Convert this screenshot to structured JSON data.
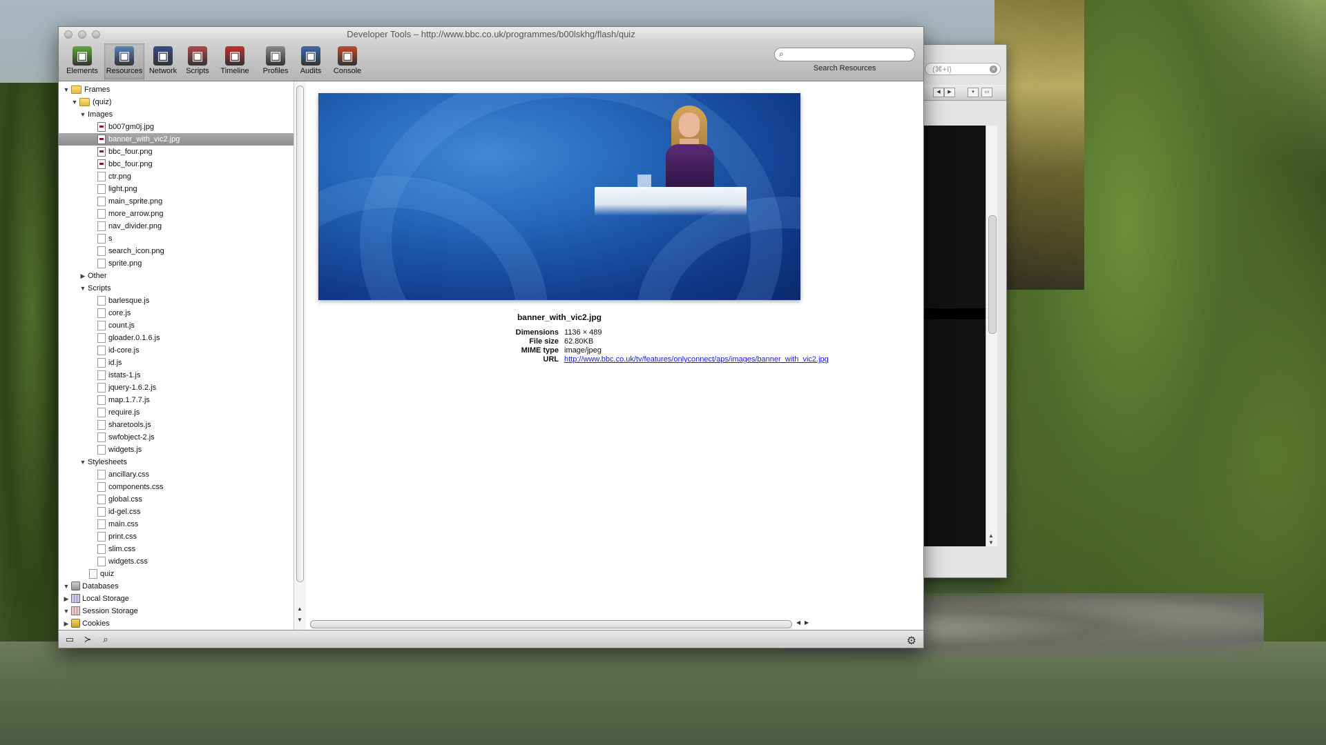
{
  "window": {
    "title": "Developer Tools – http://www.bbc.co.uk/programmes/b00lskhg/flash/quiz"
  },
  "toolbar": {
    "tools": [
      {
        "label": "Elements",
        "icon": "elements-icon",
        "color": "#5fa83c"
      },
      {
        "label": "Resources",
        "icon": "resources-icon",
        "color": "#5b7fb8",
        "active": true
      },
      {
        "label": "Network",
        "icon": "network-icon",
        "color": "#3a4a8a"
      },
      {
        "label": "Scripts",
        "icon": "scripts-icon",
        "color": "#b04848"
      },
      {
        "label": "Timeline",
        "icon": "timeline-icon",
        "color": "#c03030"
      },
      {
        "label": "Profiles",
        "icon": "profiles-icon",
        "color": "#8a8a8a"
      },
      {
        "label": "Audits",
        "icon": "audits-icon",
        "color": "#3c6aa8"
      },
      {
        "label": "Console",
        "icon": "console-icon",
        "color": "#c04a2a"
      }
    ],
    "search_label": "Search Resources",
    "search_value": ""
  },
  "sidebar": {
    "items": [
      {
        "label": "Frames",
        "depth": 0,
        "tri": "open",
        "icon": "folder"
      },
      {
        "label": "(quiz)",
        "depth": 1,
        "tri": "open",
        "icon": "folder"
      },
      {
        "label": "Images",
        "depth": 2,
        "tri": "open",
        "icon": "none"
      },
      {
        "label": "b007gm0j.jpg",
        "depth": 3,
        "icon": "img"
      },
      {
        "label": "banner_with_vic2.jpg",
        "depth": 3,
        "icon": "img",
        "selected": true
      },
      {
        "label": "bbc_four.png",
        "depth": 3,
        "icon": "img"
      },
      {
        "label": "bbc_four.png",
        "depth": 3,
        "icon": "img"
      },
      {
        "label": "ctr.png",
        "depth": 3,
        "icon": "file"
      },
      {
        "label": "light.png",
        "depth": 3,
        "icon": "file"
      },
      {
        "label": "main_sprite.png",
        "depth": 3,
        "icon": "file"
      },
      {
        "label": "more_arrow.png",
        "depth": 3,
        "icon": "file"
      },
      {
        "label": "nav_divider.png",
        "depth": 3,
        "icon": "file"
      },
      {
        "label": "s",
        "depth": 3,
        "icon": "file"
      },
      {
        "label": "search_icon.png",
        "depth": 3,
        "icon": "file"
      },
      {
        "label": "sprite.png",
        "depth": 3,
        "icon": "file"
      },
      {
        "label": "Other",
        "depth": 2,
        "tri": "closed",
        "icon": "none"
      },
      {
        "label": "Scripts",
        "depth": 2,
        "tri": "open",
        "icon": "none"
      },
      {
        "label": "barlesque.js",
        "depth": 3,
        "icon": "file"
      },
      {
        "label": "core.js",
        "depth": 3,
        "icon": "file"
      },
      {
        "label": "count.js",
        "depth": 3,
        "icon": "file"
      },
      {
        "label": "gloader.0.1.6.js",
        "depth": 3,
        "icon": "file"
      },
      {
        "label": "id-core.js",
        "depth": 3,
        "icon": "file"
      },
      {
        "label": "id.js",
        "depth": 3,
        "icon": "file"
      },
      {
        "label": "istats-1.js",
        "depth": 3,
        "icon": "file"
      },
      {
        "label": "jquery-1.6.2.js",
        "depth": 3,
        "icon": "file"
      },
      {
        "label": "map.1.7.7.js",
        "depth": 3,
        "icon": "file"
      },
      {
        "label": "require.js",
        "depth": 3,
        "icon": "file"
      },
      {
        "label": "sharetools.js",
        "depth": 3,
        "icon": "file"
      },
      {
        "label": "swfobject-2.js",
        "depth": 3,
        "icon": "file"
      },
      {
        "label": "widgets.js",
        "depth": 3,
        "icon": "file"
      },
      {
        "label": "Stylesheets",
        "depth": 2,
        "tri": "open",
        "icon": "none"
      },
      {
        "label": "ancillary.css",
        "depth": 3,
        "icon": "file"
      },
      {
        "label": "components.css",
        "depth": 3,
        "icon": "file"
      },
      {
        "label": "global.css",
        "depth": 3,
        "icon": "file"
      },
      {
        "label": "id-gel.css",
        "depth": 3,
        "icon": "file"
      },
      {
        "label": "main.css",
        "depth": 3,
        "icon": "file"
      },
      {
        "label": "print.css",
        "depth": 3,
        "icon": "file"
      },
      {
        "label": "slim.css",
        "depth": 3,
        "icon": "file"
      },
      {
        "label": "widgets.css",
        "depth": 3,
        "icon": "file"
      },
      {
        "label": "quiz",
        "depth": 2,
        "icon": "file"
      },
      {
        "label": "Databases",
        "depth": 0,
        "tri": "open",
        "icon": "db"
      },
      {
        "label": "Local Storage",
        "depth": 0,
        "tri": "closed",
        "icon": "grid"
      },
      {
        "label": "Session Storage",
        "depth": 0,
        "tri": "open",
        "icon": "grid-red"
      },
      {
        "label": "Cookies",
        "depth": 0,
        "tri": "closed",
        "icon": "cookie"
      }
    ]
  },
  "preview": {
    "filename": "banner_with_vic2.jpg",
    "meta": [
      {
        "key": "Dimensions",
        "value": "1136 × 489"
      },
      {
        "key": "File size",
        "value": "62.80KB"
      },
      {
        "key": "MIME type",
        "value": "image/jpeg"
      },
      {
        "key": "URL",
        "value": "http://www.bbc.co.uk/tv/features/onlyconnect/aps/images/banner_with_vic2.jpg",
        "link": true
      }
    ]
  },
  "background_window": {
    "search_placeholder": "(⌘+I)"
  }
}
